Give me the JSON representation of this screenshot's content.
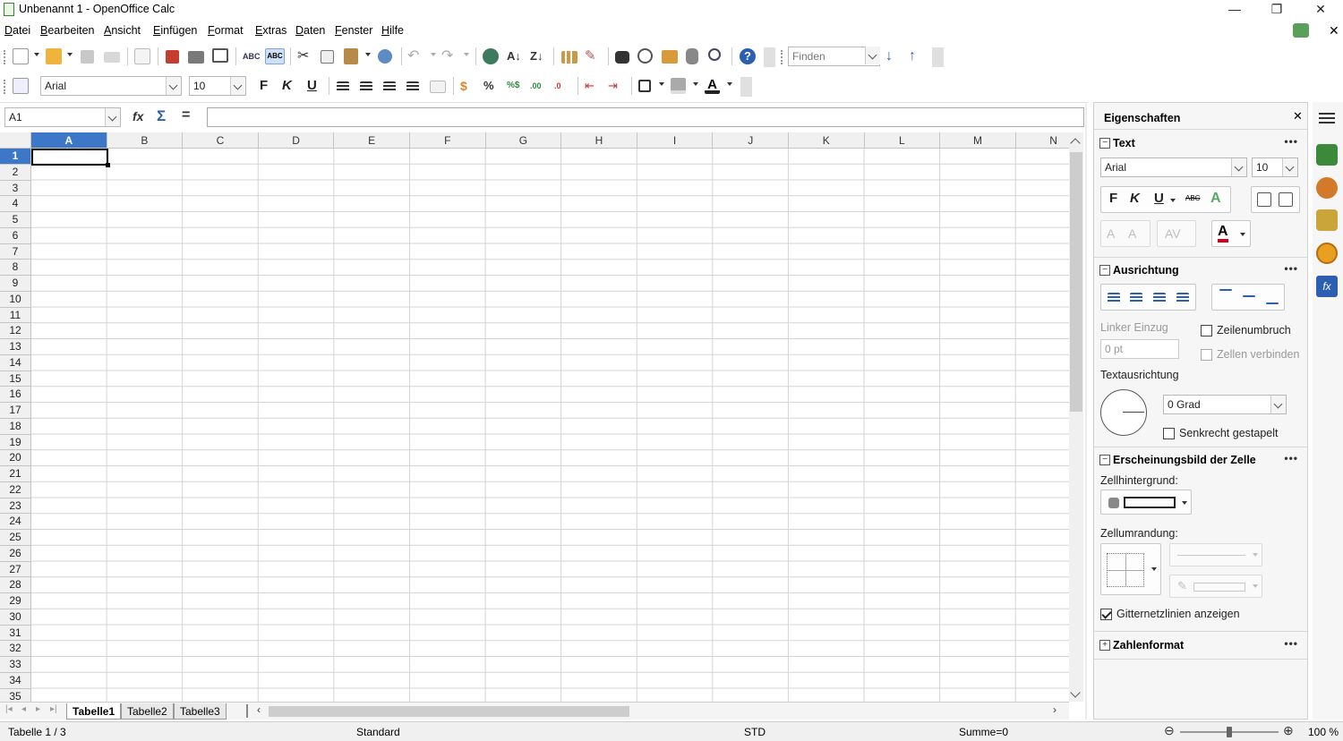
{
  "window": {
    "title": "Unbenannt 1 - OpenOffice Calc",
    "minimize_glyph": "—",
    "restore_glyph": "❐",
    "close_glyph": "✕",
    "doc_close_glyph": "✕"
  },
  "menu": {
    "items": [
      "Datei",
      "Bearbeiten",
      "Ansicht",
      "Einfügen",
      "Format",
      "Extras",
      "Daten",
      "Fenster",
      "Hilfe"
    ]
  },
  "toolbar1": {
    "find_placeholder": "Finden",
    "icons": [
      "new-icon",
      "open-icon",
      "save-icon",
      "email-icon",
      "edit-file-icon",
      "export-pdf-icon",
      "print-icon",
      "print-preview-icon",
      "spellcheck-icon",
      "autospell-icon",
      "cut-icon",
      "copy-icon",
      "paste-icon",
      "clone-formatting-icon",
      "undo-icon",
      "redo-icon",
      "hyperlink-icon",
      "sort-ascending-icon",
      "sort-descending-icon",
      "chart-icon",
      "draw-functions-icon",
      "find-replace-icon",
      "navigator-icon",
      "gallery-icon",
      "data-sources-icon",
      "zoom-icon",
      "help-icon"
    ]
  },
  "toolbar2": {
    "font_name": "Arial",
    "font_size": "10",
    "bold_label": "F",
    "italic_label": "K",
    "underline_label": "U"
  },
  "formula": {
    "name_box": "A1",
    "function_wizard_glyph": "fx",
    "sum_glyph": "Σ",
    "equals_glyph": "=",
    "input_value": ""
  },
  "sheet": {
    "columns": [
      "A",
      "B",
      "C",
      "D",
      "E",
      "F",
      "G",
      "H",
      "I",
      "J",
      "K",
      "L",
      "M",
      "N"
    ],
    "rows": [
      "1",
      "2",
      "3",
      "4",
      "5",
      "6",
      "7",
      "8",
      "9",
      "10",
      "11",
      "12",
      "13",
      "14",
      "15",
      "16",
      "17",
      "18",
      "19",
      "20",
      "21",
      "22",
      "23",
      "24",
      "25",
      "26",
      "27",
      "28",
      "29",
      "30",
      "31",
      "32",
      "33",
      "34",
      "35"
    ],
    "active_cell": "A1",
    "tabs": [
      "Tabelle1",
      "Tabelle2",
      "Tabelle3"
    ],
    "active_tab": "Tabelle1"
  },
  "status": {
    "sheet_info": "Tabelle 1 / 3",
    "page_style": "Standard",
    "mode": "STD",
    "sum": "Summe=0",
    "zoom": "100 %",
    "zoom_fraction": 0.5
  },
  "sidebar": {
    "title": "Eigenschaften",
    "close_glyph": "✕",
    "text_section": {
      "title": "Text",
      "font_name": "Arial",
      "font_size": "10",
      "bold": "F",
      "italic": "K",
      "underline": "U",
      "strike": "ABC"
    },
    "alignment_section": {
      "title": "Ausrichtung",
      "indent_label": "Linker Einzug",
      "indent_value": "0 pt",
      "wrap_label": "Zeilenumbruch",
      "merge_label": "Zellen verbinden",
      "text_direction_label": "Textausrichtung",
      "angle_value": "0 Grad",
      "vertical_stacked_label": "Senkrecht gestapelt"
    },
    "cell_appearance_section": {
      "title": "Erscheinungsbild der Zelle",
      "background_label": "Zellhintergrund:",
      "border_label": "Zellumrandung:",
      "gridlines_label": "Gitternetzlinien anzeigen",
      "gridlines_checked": true
    },
    "number_format_section": {
      "title": "Zahlenformat"
    },
    "section_menu_glyph": "•••",
    "collapse_glyph": "−",
    "expand_glyph": "+"
  },
  "colors": {
    "selection_blue": "#3d78c8",
    "font_color_red": "#d0021b",
    "accent_green": "#3a8a3a"
  }
}
